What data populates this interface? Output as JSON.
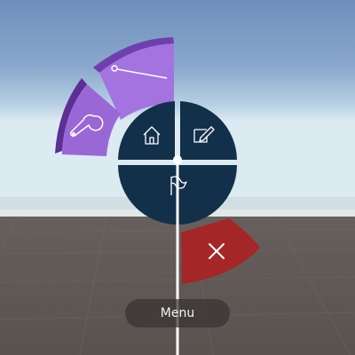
{
  "window": {
    "title": ""
  },
  "radial_menu": {
    "center_buttons": [
      {
        "name": "home",
        "icon": "home-icon"
      },
      {
        "name": "edit",
        "icon": "edit-icon"
      },
      {
        "name": "flag",
        "icon": "flag-icon"
      }
    ],
    "outer_buttons": [
      {
        "name": "slider",
        "icon": "slider-icon"
      },
      {
        "name": "settings",
        "icon": "wrench-icon"
      },
      {
        "name": "close",
        "icon": "close-icon"
      }
    ]
  },
  "bottom_bar": {
    "label": "Menu"
  },
  "colors": {
    "sky_top": "#6f8fbc",
    "sky_horizon": "#d9eaf2",
    "ground": "#5e5654",
    "center_button_fill": "#13304a",
    "outer_button_fill": "#9b69d6",
    "outer_button_accent": "#6f3fae",
    "close_button_fill": "#a52626",
    "pointer_line": "#ffffff",
    "icon_stroke": "#ffffff"
  }
}
